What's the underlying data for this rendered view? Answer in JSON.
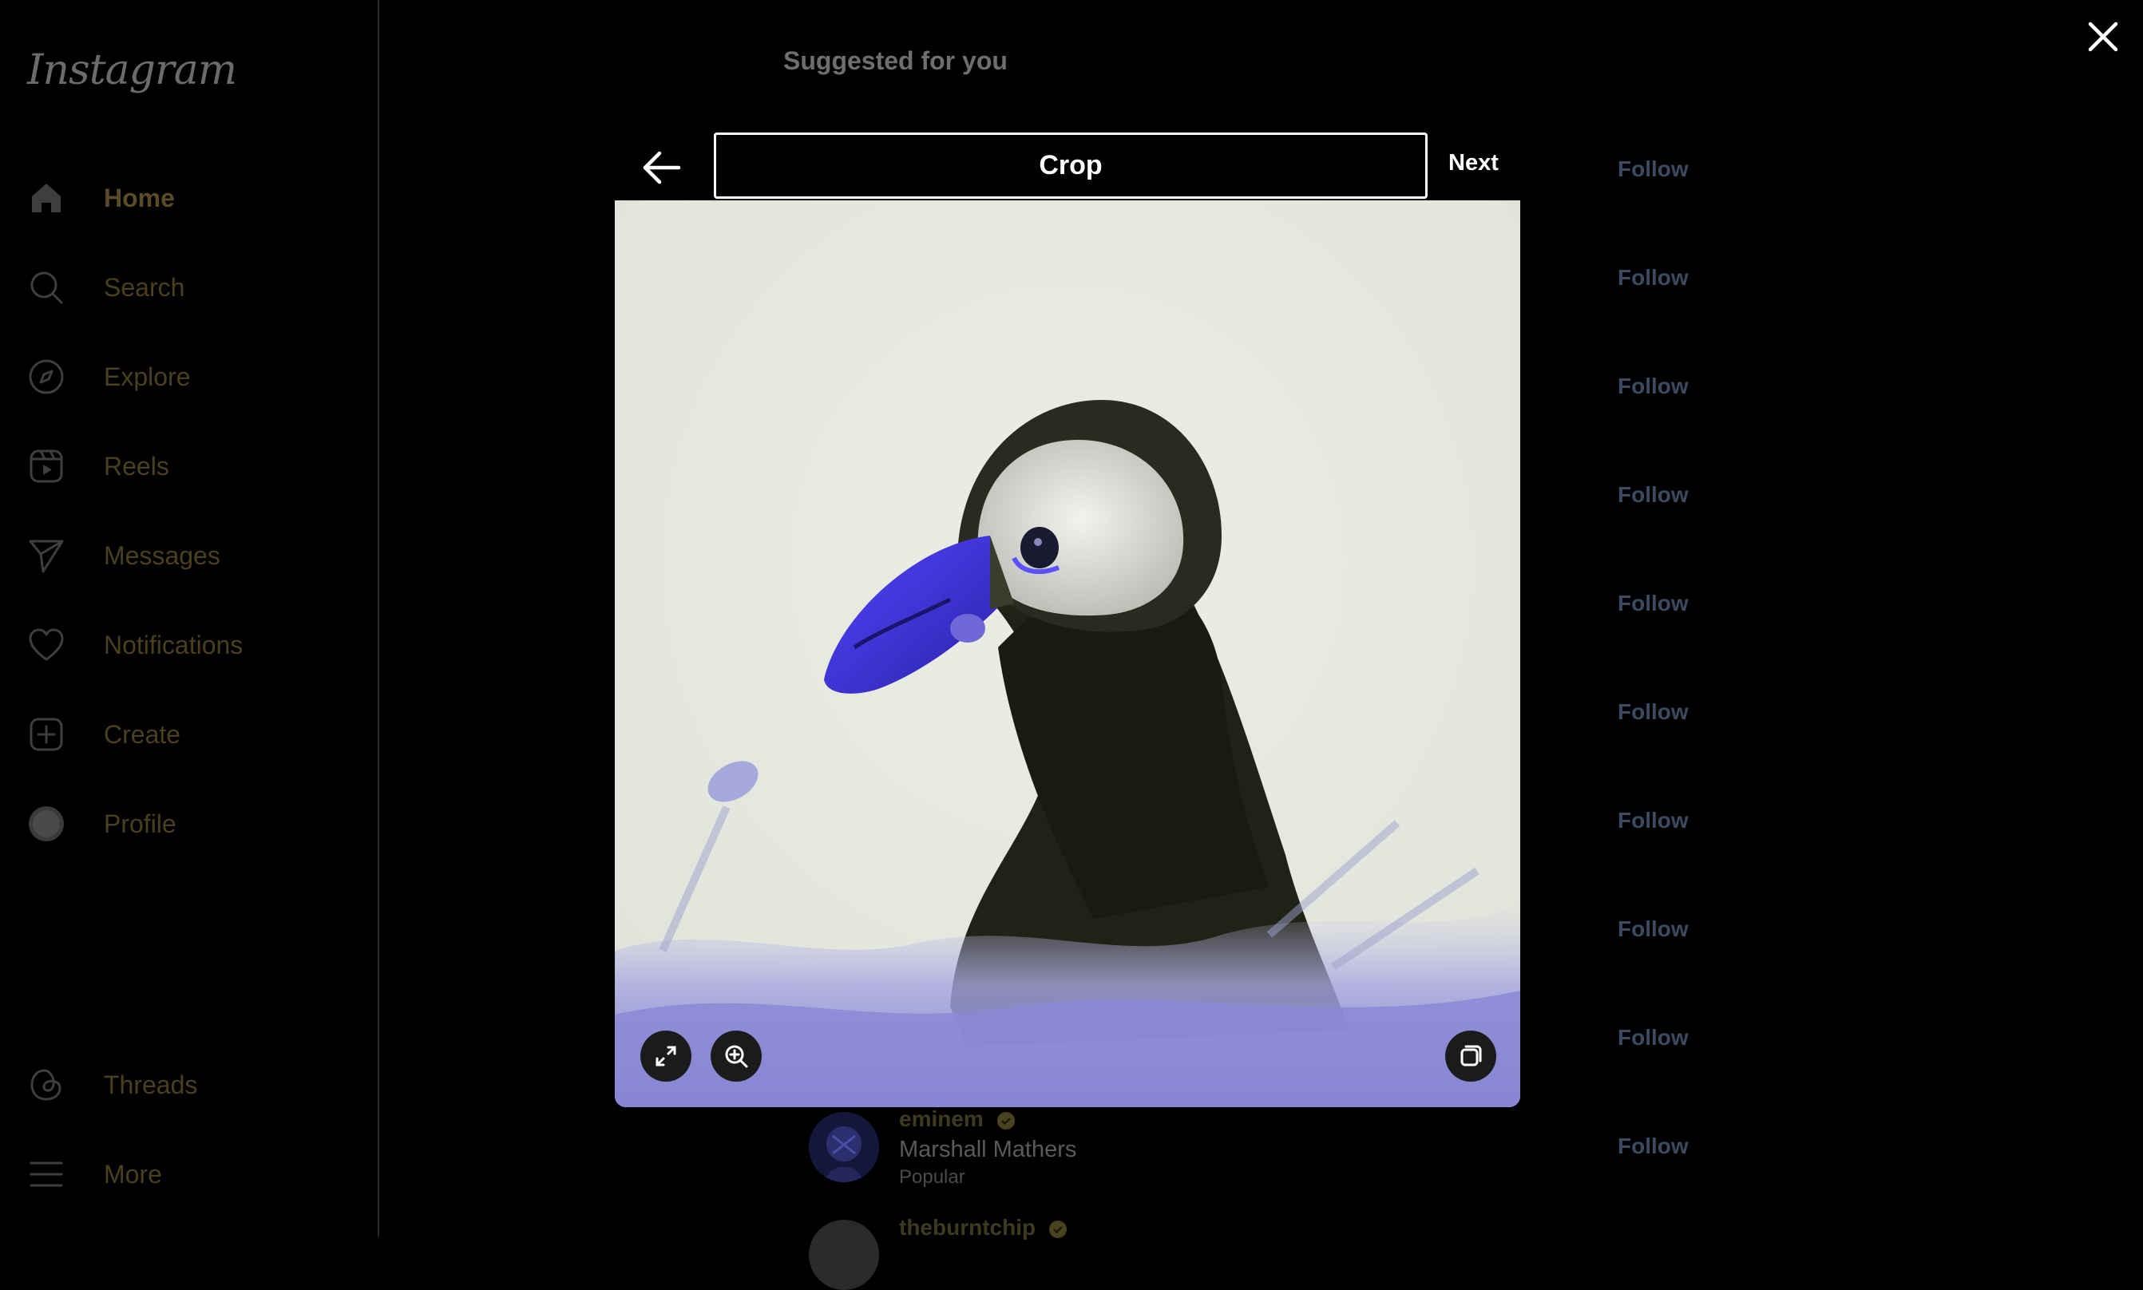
{
  "app": {
    "logo": "Instagram"
  },
  "sidebar": {
    "items": [
      {
        "label": "Home",
        "icon": "home-icon"
      },
      {
        "label": "Search",
        "icon": "search-icon"
      },
      {
        "label": "Explore",
        "icon": "compass-icon"
      },
      {
        "label": "Reels",
        "icon": "reels-icon"
      },
      {
        "label": "Messages",
        "icon": "send-icon"
      },
      {
        "label": "Notifications",
        "icon": "heart-icon"
      },
      {
        "label": "Create",
        "icon": "plus-square-icon"
      },
      {
        "label": "Profile",
        "icon": "avatar-icon"
      },
      {
        "label": "Threads",
        "icon": "threads-icon"
      },
      {
        "label": "More",
        "icon": "menu-icon"
      }
    ]
  },
  "feed": {
    "title": "Suggested for you",
    "follow_label": "Follow",
    "suggestions": [
      {
        "username": "eminem",
        "full_name": "Marshall Mathers",
        "subtitle": "Popular"
      },
      {
        "username": "theburntchip",
        "full_name": "",
        "subtitle": ""
      }
    ]
  },
  "modal": {
    "title": "Crop",
    "next_label": "Next",
    "tools": [
      "expand-icon",
      "zoom-in-icon",
      "multiple-media-icon"
    ]
  },
  "colors": {
    "background": "#000000",
    "follow_text": "#3c4a61",
    "beak_blue": "#3a2fd6"
  }
}
